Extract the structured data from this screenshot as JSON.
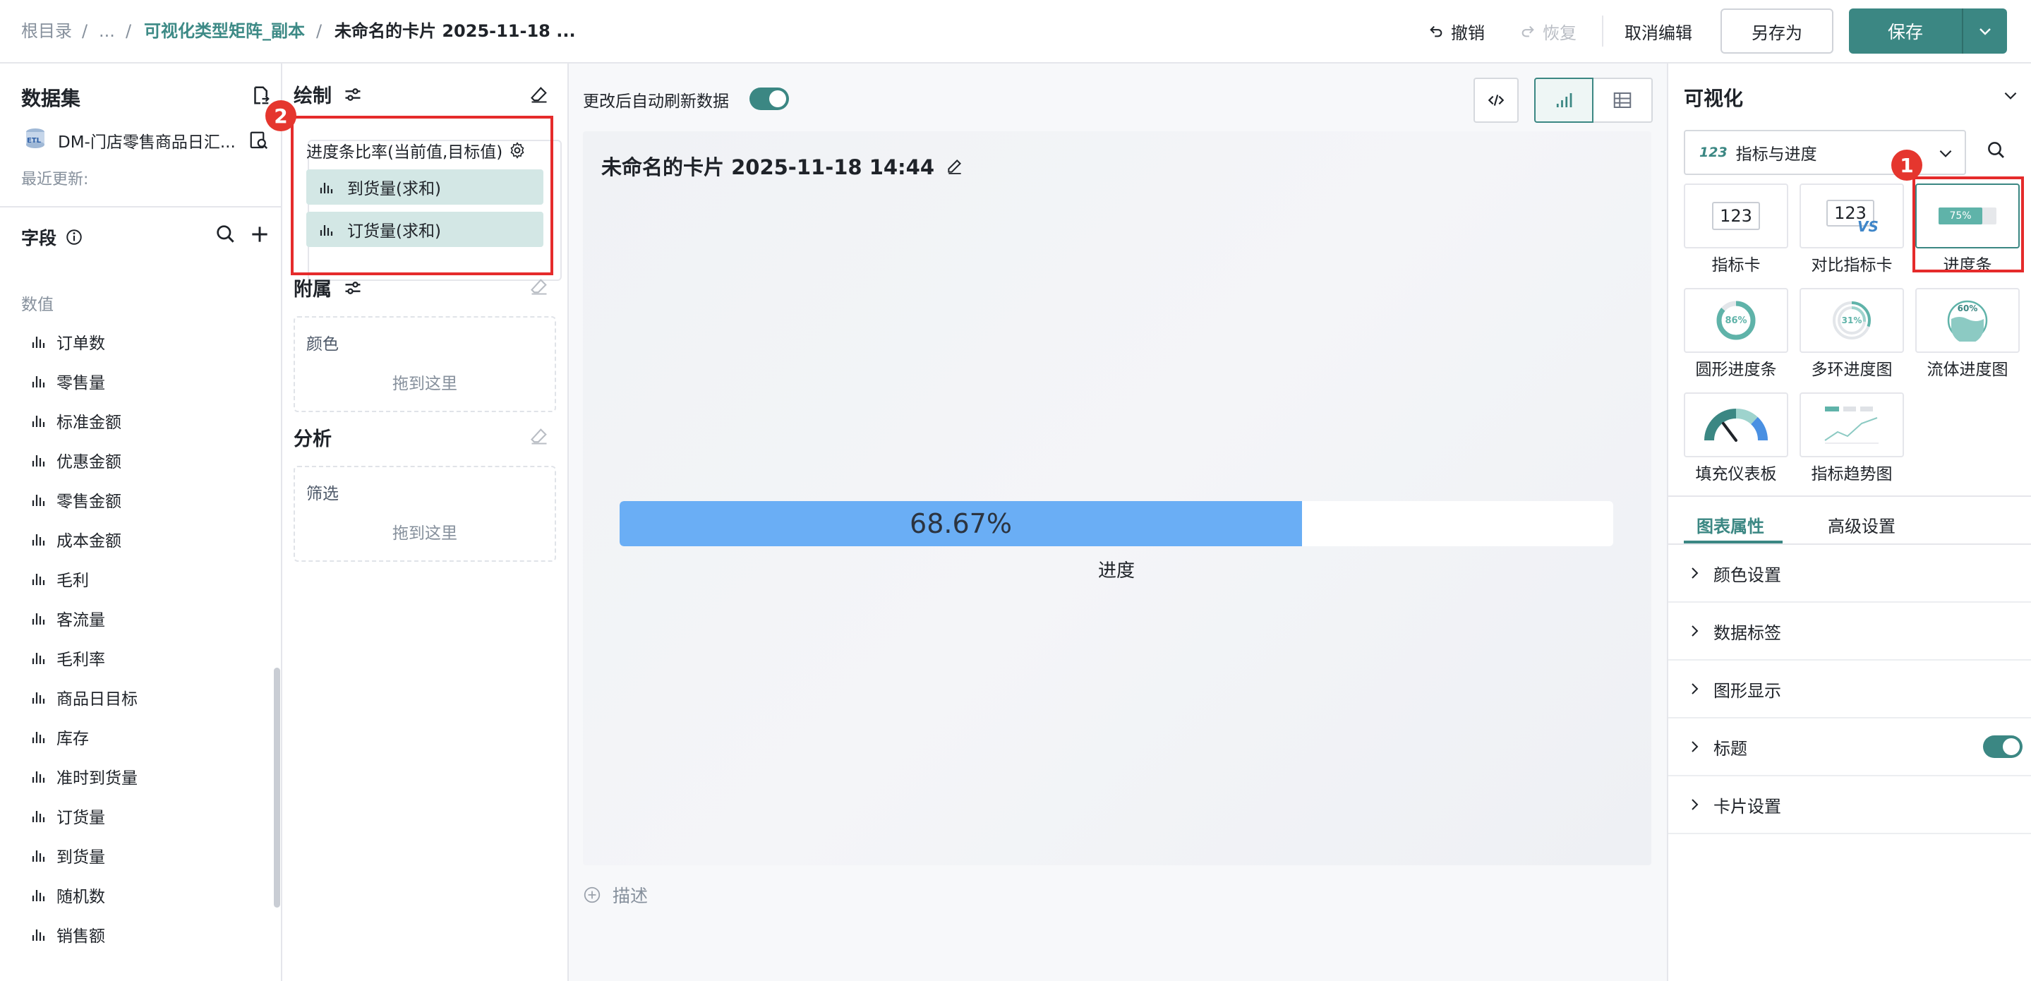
{
  "topbar": {
    "crumb_root": "根目录",
    "crumb_sep1": "/",
    "crumb_ellipsis": "...",
    "crumb_sep2": "/",
    "crumb_parent": "可视化类型矩阵_副本",
    "crumb_sep3": "/",
    "crumb_current": "未命名的卡片 2025-11-18 ...",
    "undo": "撤销",
    "redo": "恢复",
    "cancel_edit": "取消编辑",
    "save_as": "另存为",
    "save": "保存"
  },
  "dataset": {
    "title": "数据集",
    "name": "DM-门店零售商品日汇...",
    "recent_update": "最近更新:",
    "fields_title": "字段",
    "group_label": "数值",
    "fields": [
      "订单数",
      "零售量",
      "标准金额",
      "优惠金额",
      "零售金额",
      "成本金额",
      "毛利",
      "客流量",
      "毛利率",
      "商品日目标",
      "库存",
      "准时到货量",
      "订货量",
      "到货量",
      "随机数",
      "销售额"
    ]
  },
  "config": {
    "draw_title": "绘制",
    "progress_label": "进度条比率(当前值,目标值)",
    "pills": [
      "到货量(求和)",
      "订货量(求和)"
    ],
    "attach_title": "附属",
    "color_label": "颜色",
    "drop_hint_color": "拖到这里",
    "analysis_title": "分析",
    "filter_label": "筛选",
    "drop_hint_filter": "拖到这里",
    "badge_2": "2"
  },
  "canvas": {
    "auto_refresh_label": "更改后自动刷新数据",
    "card_title": "未命名的卡片 2025-11-18 14:44",
    "progress_value": 0.6867,
    "progress_text": "68.67%",
    "progress_caption": "进度",
    "describe": "描述"
  },
  "viz": {
    "title": "可视化",
    "category": "指标与进度",
    "category_prefix": "123",
    "badge_1": "1",
    "items": [
      {
        "label": "指标卡",
        "icon": "kpi-card-icon",
        "thumb": "123"
      },
      {
        "label": "对比指标卡",
        "icon": "compare-kpi-icon",
        "thumb": "123",
        "thumb2": "VS"
      },
      {
        "label": "进度条",
        "icon": "progress-bar-icon",
        "thumb": "75%"
      },
      {
        "label": "圆形进度条",
        "icon": "ring-progress-icon",
        "thumb": "86%"
      },
      {
        "label": "多环进度图",
        "icon": "multi-ring-icon",
        "thumb": "31%"
      },
      {
        "label": "流体进度图",
        "icon": "liquid-progress-icon",
        "thumb": "60%"
      },
      {
        "label": "填充仪表板",
        "icon": "gauge-icon"
      },
      {
        "label": "指标趋势图",
        "icon": "kpi-trend-icon"
      }
    ],
    "tabs": [
      "图表属性",
      "高级设置"
    ],
    "props": [
      "颜色设置",
      "数据标签",
      "图形显示",
      "标题",
      "卡片设置"
    ]
  },
  "colors": {
    "accent": "#3b8783",
    "progress_fill": "#6aaef5",
    "highlight": "#e52b2b"
  }
}
